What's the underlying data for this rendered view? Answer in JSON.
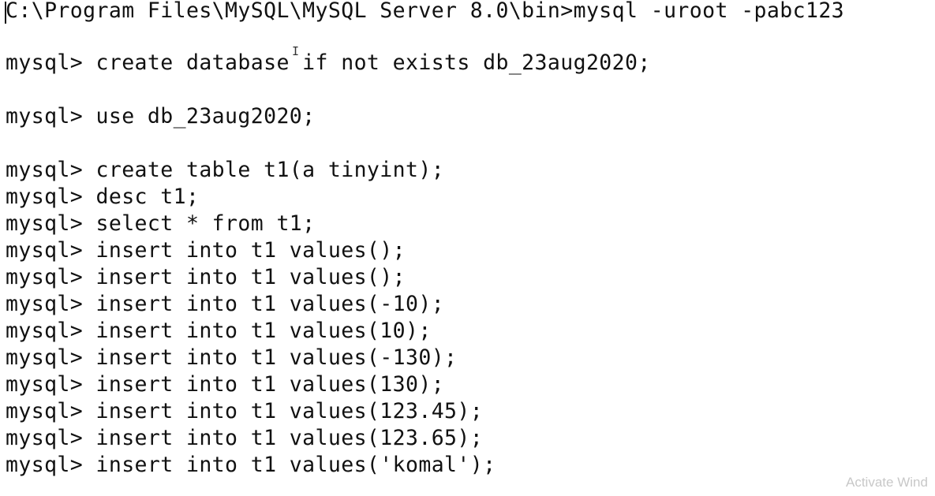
{
  "console": {
    "lines": [
      "C:\\Program Files\\MySQL\\MySQL Server 8.0\\bin>mysql -uroot -pabc123",
      "mysql> create database if not exists db_23aug2020;",
      "mysql> use db_23aug2020;",
      "mysql> create table t1(a tinyint);",
      "mysql> desc t1;",
      "mysql> select * from t1;",
      "mysql> insert into t1 values();",
      "mysql> insert into t1 values();",
      "mysql> insert into t1 values(-10);",
      "mysql> insert into t1 values(10);",
      "mysql> insert into t1 values(-130);",
      "mysql> insert into t1 values(130);",
      "mysql> insert into t1 values(123.45);",
      "mysql> insert into t1 values(123.65);",
      "mysql> insert into t1 values('komal');"
    ]
  },
  "cursor": {
    "mouse_glyph": "I"
  },
  "watermark": {
    "text": "Activate Wind"
  },
  "colors": {
    "background": "#ffffff",
    "text": "#111111",
    "watermark": "#c8c8c8"
  }
}
